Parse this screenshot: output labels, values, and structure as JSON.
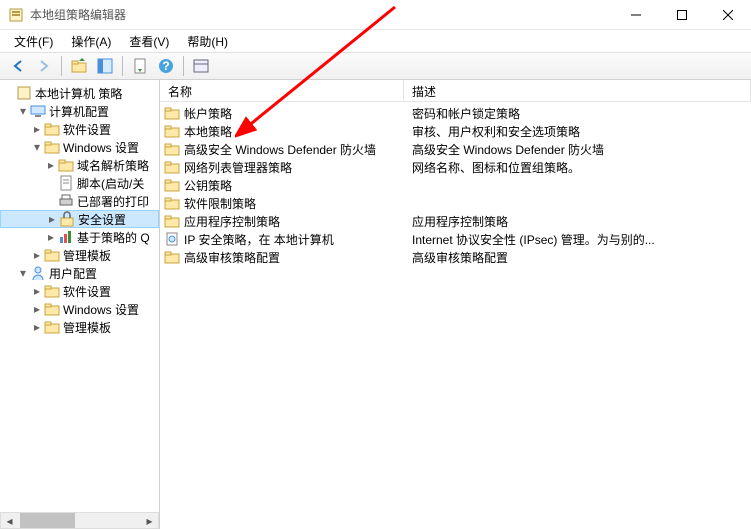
{
  "window": {
    "title": "本地组策略编辑器"
  },
  "menu": {
    "file": "文件(F)",
    "action": "操作(A)",
    "view": "查看(V)",
    "help": "帮助(H)"
  },
  "tree": {
    "root": "本地计算机 策略",
    "computer_config": "计算机配置",
    "software_settings": "软件设置",
    "windows_settings": "Windows 设置",
    "dns_policy": "域名解析策略",
    "scripts": "脚本(启动/关",
    "deployed_printers": "已部署的打印",
    "security_settings": "安全设置",
    "policy_based_qos": "基于策略的 Q",
    "admin_templates": "管理模板",
    "user_config": "用户配置",
    "user_software": "软件设置",
    "user_windows": "Windows 设置",
    "user_admin_templates": "管理模板"
  },
  "columns": {
    "name": "名称",
    "desc": "描述"
  },
  "items": [
    {
      "name": "帐户策略",
      "desc": "密码和帐户锁定策略"
    },
    {
      "name": "本地策略",
      "desc": "审核、用户权利和安全选项策略"
    },
    {
      "name": "高级安全 Windows Defender 防火墙",
      "desc": "高级安全 Windows Defender 防火墙"
    },
    {
      "name": "网络列表管理器策略",
      "desc": "网络名称、图标和位置组策略。"
    },
    {
      "name": "公钥策略",
      "desc": ""
    },
    {
      "name": "软件限制策略",
      "desc": ""
    },
    {
      "name": "应用程序控制策略",
      "desc": "应用程序控制策略"
    },
    {
      "name": "IP 安全策略，在 本地计算机",
      "desc": "Internet 协议安全性 (IPsec) 管理。为与别的..."
    },
    {
      "name": "高级审核策略配置",
      "desc": "高级审核策略配置"
    }
  ]
}
